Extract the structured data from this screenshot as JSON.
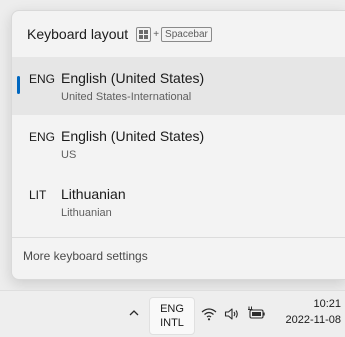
{
  "flyout": {
    "title": "Keyboard layout",
    "shortcut": {
      "plus": "+",
      "key": "Spacebar"
    },
    "layouts": [
      {
        "code": "ENG",
        "name": "English (United States)",
        "sub": "United States-International",
        "selected": true
      },
      {
        "code": "ENG",
        "name": "English (United States)",
        "sub": "US",
        "selected": false
      },
      {
        "code": "LIT",
        "name": "Lithuanian",
        "sub": "Lithuanian",
        "selected": false
      }
    ],
    "more_link": "More keyboard settings"
  },
  "taskbar": {
    "lang_line1": "ENG",
    "lang_line2": "INTL",
    "time": "10:21",
    "date": "2022-11-08",
    "icons": [
      "chevron-up-icon",
      "wifi-icon",
      "speaker-icon",
      "battery-plug-icon"
    ]
  },
  "colors": {
    "accent": "#0067c0",
    "flyout_bg": "#f3f3f3",
    "selected_bg": "#e6e6e6"
  }
}
